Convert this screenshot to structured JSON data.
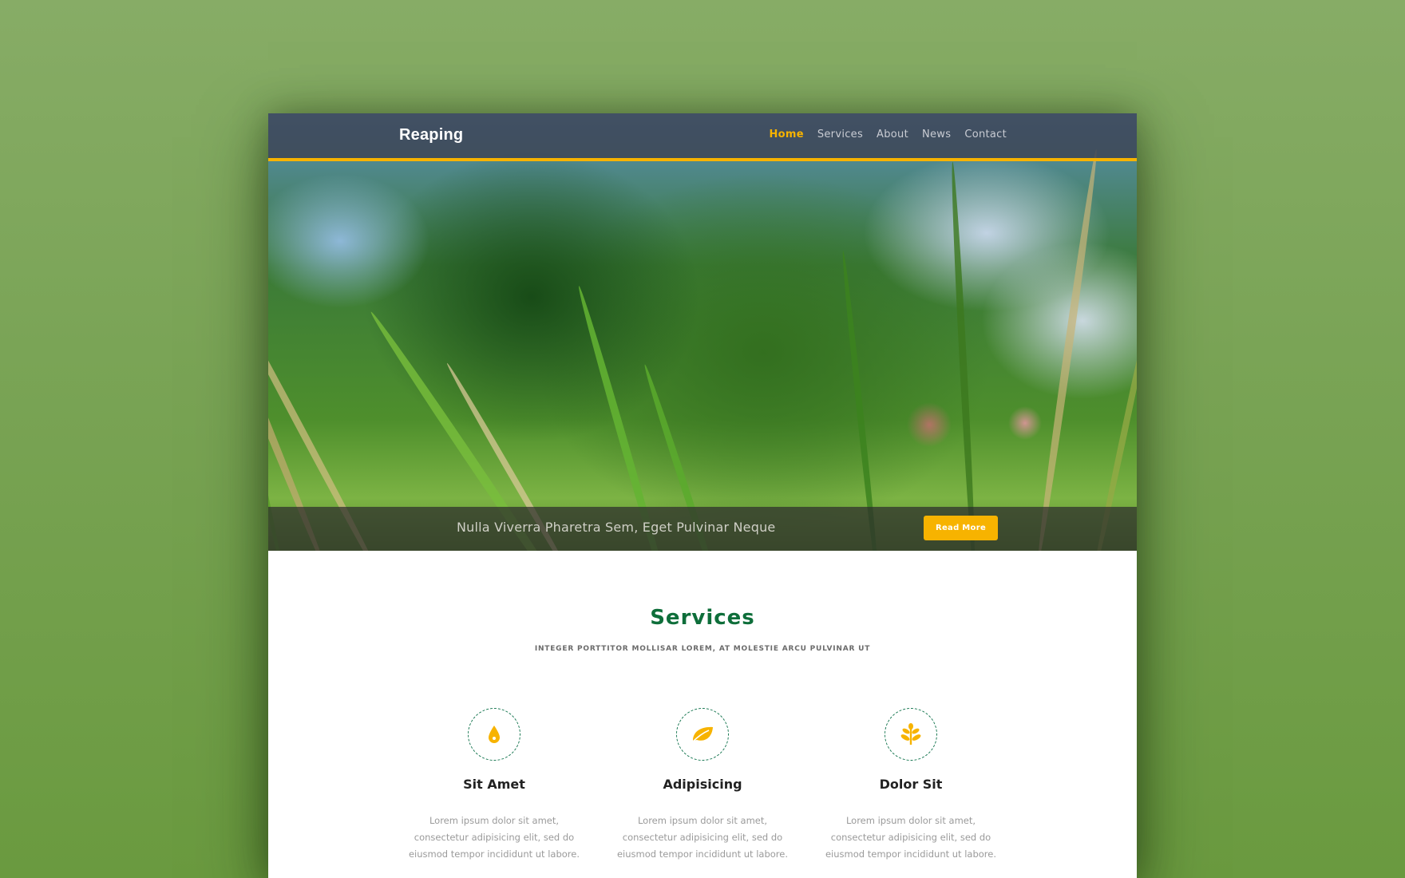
{
  "header": {
    "brand": "Reaping",
    "nav": [
      {
        "label": "Home",
        "active": true
      },
      {
        "label": "Services",
        "active": false
      },
      {
        "label": "About",
        "active": false
      },
      {
        "label": "News",
        "active": false
      },
      {
        "label": "Contact",
        "active": false
      }
    ]
  },
  "hero": {
    "caption": "Nulla Viverra Pharetra Sem, Eget Pulvinar Neque",
    "button_label": "Read More"
  },
  "services": {
    "title": "Services",
    "subtitle": "INTEGER PORTTITOR MOLLISAR LOREM, AT MOLESTIE ARCU PULVINAR UT",
    "items": [
      {
        "icon": "water-drop-icon",
        "name": "Sit Amet",
        "description": "Lorem ipsum dolor sit amet, consectetur adipisicing elit, sed do eiusmod tempor incididunt ut labore."
      },
      {
        "icon": "leaf-icon",
        "name": "Adipisicing",
        "description": "Lorem ipsum dolor sit amet, consectetur adipisicing elit, sed do eiusmod tempor incididunt ut labore."
      },
      {
        "icon": "sprout-icon",
        "name": "Dolor Sit",
        "description": "Lorem ipsum dolor sit amet, consectetur adipisicing elit, sed do eiusmod tempor incididunt ut labore."
      }
    ]
  },
  "colors": {
    "accent": "#f7b300",
    "heading_green": "#0e6e3a",
    "navbar": "#3c4252"
  }
}
